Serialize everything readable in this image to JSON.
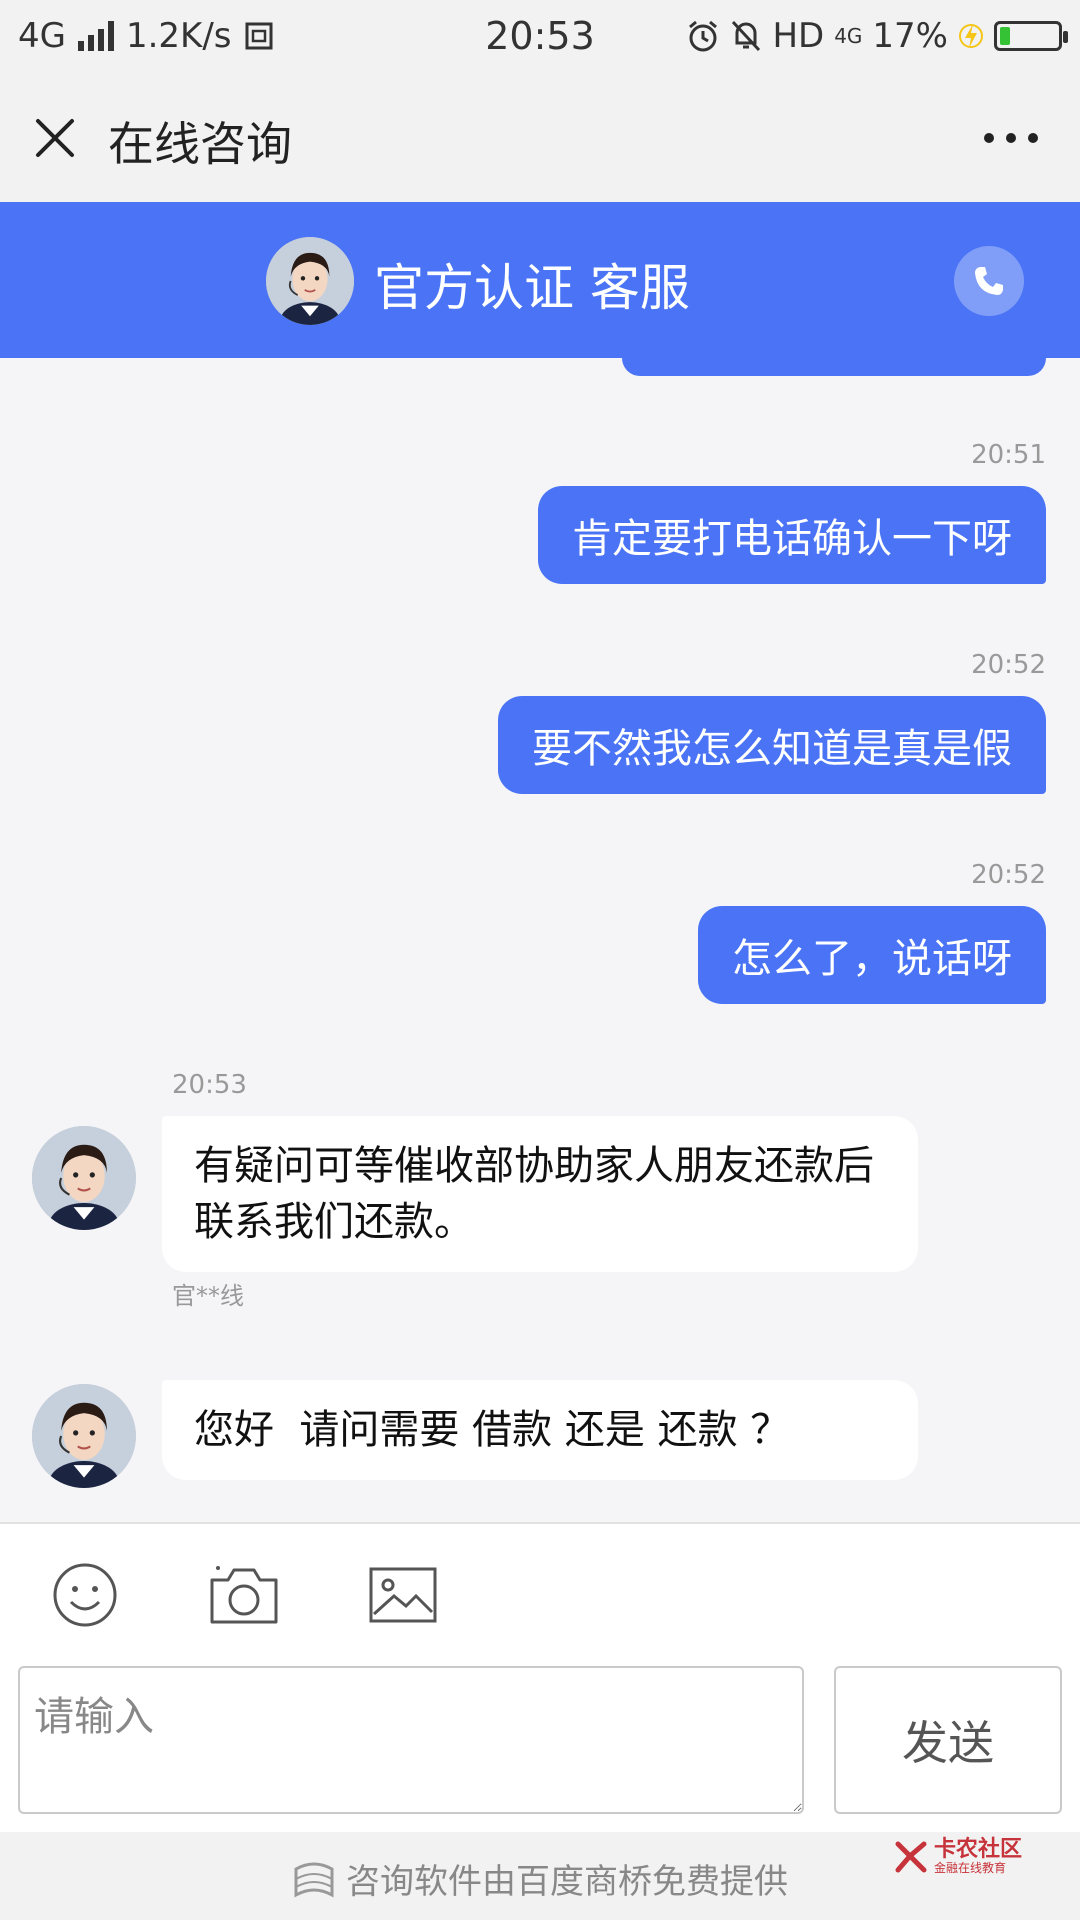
{
  "status_bar": {
    "network": "4G",
    "speed": "1.2K/s",
    "time": "20:53",
    "hd": "HD",
    "net2": "4G",
    "battery": "17%",
    "battery_level": 0.17
  },
  "titlebar": {
    "title": "在线咨询",
    "close_icon": "close-icon",
    "more_icon": "more-icon"
  },
  "agent_header": {
    "name": "官方认证 客服",
    "phone_icon": "phone-icon"
  },
  "messages": [
    {
      "time": "20:51",
      "text": "肯定要打电话确认一下呀",
      "side": "out"
    },
    {
      "time": "20:52",
      "text": "要不然我怎么知道是真是假",
      "side": "out"
    },
    {
      "time": "20:52",
      "text": "怎么了，说话呀",
      "side": "out"
    },
    {
      "time": "20:53",
      "text": "有疑问可等催收部协助家人朋友还款后联系我们还款。",
      "side": "in",
      "sender": "官**线"
    },
    {
      "text": "您好  请问需要 借款 还是 还款 ？",
      "side": "in"
    }
  ],
  "input": {
    "placeholder": "请输入",
    "send_label": "发送",
    "tools": [
      "emoji-icon",
      "camera-icon",
      "image-icon"
    ]
  },
  "footer": {
    "credit": "咨询软件由百度商桥免费提供",
    "watermark_main": "卡农社区",
    "watermark_sub": "金融在线教育"
  },
  "colors": {
    "accent": "#4a74f5",
    "background": "#f5f5f7",
    "battery_fill": "#35c335"
  }
}
